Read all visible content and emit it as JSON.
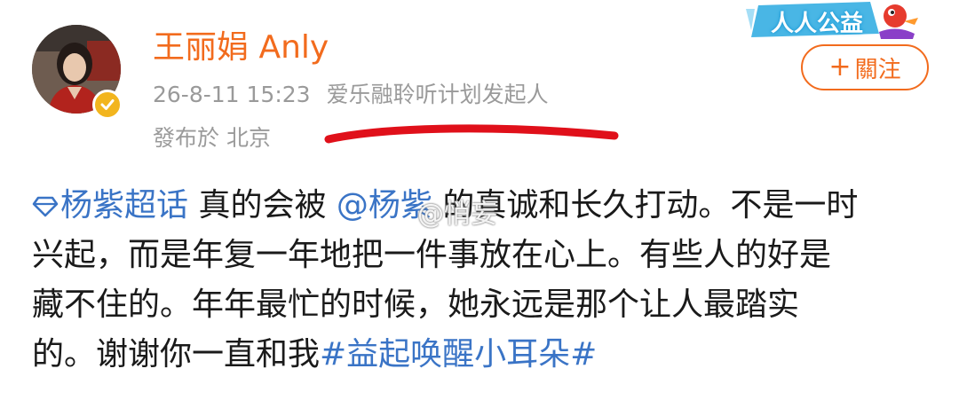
{
  "user": {
    "name": "王丽娟 Anly",
    "timestamp": "26-8-11 15:23",
    "title": "爱乐融聆听计划发起人",
    "location": "發布於 北京"
  },
  "badge": {
    "text": "人人公益"
  },
  "follow": {
    "plus": "+",
    "label": "關注"
  },
  "post": {
    "topic": "杨紫超话",
    "line1_a": " 真的会被 ",
    "mention": "@杨紫",
    "line1_b": " 的真诚和长久打动。不是一时",
    "line2": "兴起，而是年复一年地把一件事放在心上。有些人的好是",
    "line3": "藏不住的。年年最忙的时候，她永远是那个让人最踏实",
    "line4_a": "的。谢谢你一直和我",
    "hashtag": "#益起唤醒小耳朵#"
  },
  "watermark": "@悄妄",
  "colors": {
    "accent": "#f26b1d",
    "link": "#3a74c6",
    "meta": "#9a9a9a",
    "underline": "#e0101a"
  }
}
